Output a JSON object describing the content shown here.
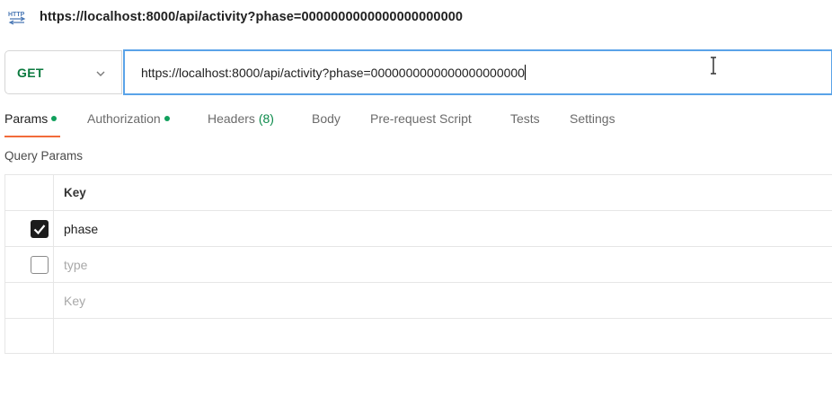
{
  "header": {
    "icon": "http-icon",
    "title": "https://localhost:8000/api/activity?phase=0000000000000000000000"
  },
  "request": {
    "method": "GET",
    "url": "https://localhost:8000/api/activity?phase=0000000000000000000000"
  },
  "tabs": [
    {
      "label": "Params",
      "active": true,
      "dot": true
    },
    {
      "label": "Authorization",
      "active": false,
      "dot": true
    },
    {
      "label": "Headers",
      "count": "(8)",
      "active": false
    },
    {
      "label": "Body",
      "active": false
    },
    {
      "label": "Pre-request Script",
      "active": false
    },
    {
      "label": "Tests",
      "active": false
    },
    {
      "label": "Settings",
      "active": false
    }
  ],
  "query_params": {
    "section_label": "Query Params",
    "column_key": "Key",
    "rows": [
      {
        "checked": true,
        "key": "phase"
      },
      {
        "checked": false,
        "key_placeholder": "type"
      }
    ],
    "new_row_placeholder": "Key"
  },
  "colors": {
    "method": "#0b7a3f",
    "active_tab_underline": "#f26b3a",
    "status_dot": "#10a05c",
    "url_focus_border": "#5aa3e8"
  }
}
